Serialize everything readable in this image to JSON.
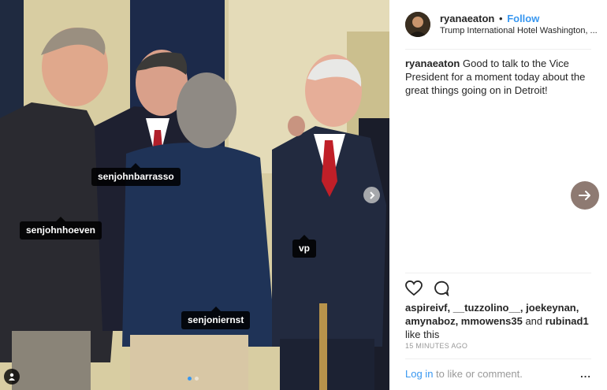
{
  "post": {
    "username": "ryanaeaton",
    "follow_label": "Follow",
    "bullet": "•",
    "location": "Trump International Hotel Washington, ...",
    "caption_text": "Good to talk to the Vice President for a moment today about the great things going on in Detroit!"
  },
  "photo_tags": [
    {
      "label": "senjohnbarrasso"
    },
    {
      "label": "senjohnhoeven"
    },
    {
      "label": "vp"
    },
    {
      "label": "senjoniernst"
    }
  ],
  "likes": {
    "names_line": "aspireivf, __tuzzolino__, joekeynan, amynaboz, mmowens35",
    "and_text": "and",
    "last_name": "rubinad1",
    "suffix": "like this"
  },
  "timestamp": "15 MINUTES AGO",
  "comment": {
    "login_label": "Log in",
    "rest_text": "to like or comment.",
    "more_label": "..."
  },
  "icons": {
    "heart": "heart-icon",
    "comment": "comment-icon",
    "next": "arrow-right-icon",
    "user_tag": "user-tag-icon"
  },
  "colors": {
    "link_blue": "#3897f0",
    "text": "#262626",
    "muted": "#999999",
    "next_arrow_bg": "#8e7a72"
  },
  "carousel": {
    "current": 1,
    "total": 2
  }
}
